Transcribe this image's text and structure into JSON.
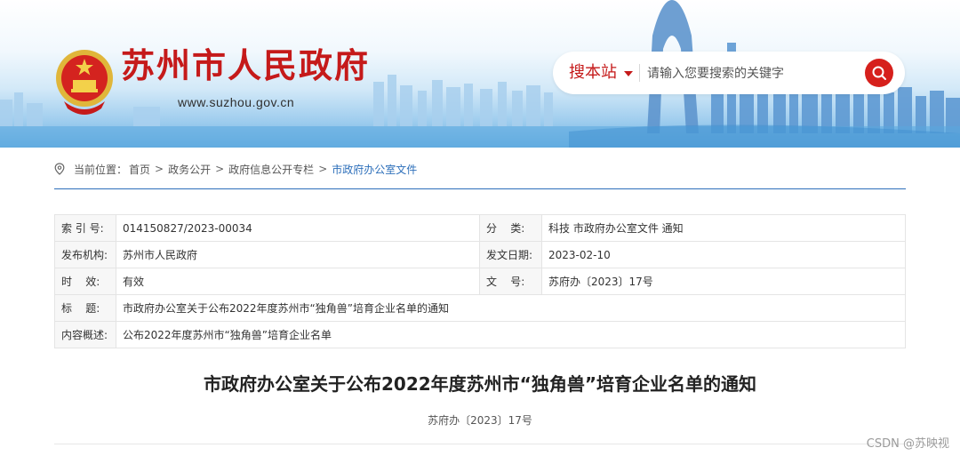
{
  "header": {
    "site_title": "苏州市人民政府",
    "site_url": "www.suzhou.gov.cn",
    "search": {
      "scope": "搜本站",
      "placeholder": "请输入您要搜索的关键字"
    },
    "icons": [
      "national-emblem-icon",
      "chevron-down-icon",
      "search-icon"
    ]
  },
  "breadcrumb": {
    "prefix": "当前位置：",
    "items": [
      "首页",
      "政务公开",
      "政府信息公开专栏",
      "市政府办公室文件"
    ],
    "separator": ">"
  },
  "info": {
    "index_label": "索 引 号:",
    "index_value": "014150827/2023-00034",
    "category_label": "分    类:",
    "category_value": "科技 市政府办公室文件 通知",
    "publisher_label": "发布机构:",
    "publisher_value": "苏州市人民政府",
    "date_label": "发文日期:",
    "date_value": "2023-02-10",
    "validity_label": "时    效:",
    "validity_value": "有效",
    "docno_label": "文    号:",
    "docno_value": "苏府办〔2023〕17号",
    "title_label": "标    题:",
    "title_value": "市政府办公室关于公布2022年度苏州市“独角兽”培育企业名单的通知",
    "summary_label": "内容概述:",
    "summary_value": "公布2022年度苏州市“独角兽”培育企业名单"
  },
  "article": {
    "title": "市政府办公室关于公布2022年度苏州市“独角兽”培育企业名单的通知",
    "doc_number": "苏府办〔2023〕17号"
  },
  "watermark": "CSDN @苏映视",
  "colors": {
    "brand_red": "#c51a1a",
    "search_button": "#d6201c",
    "link_blue": "#2d6fba",
    "label_bg": "#f7f7f7"
  }
}
